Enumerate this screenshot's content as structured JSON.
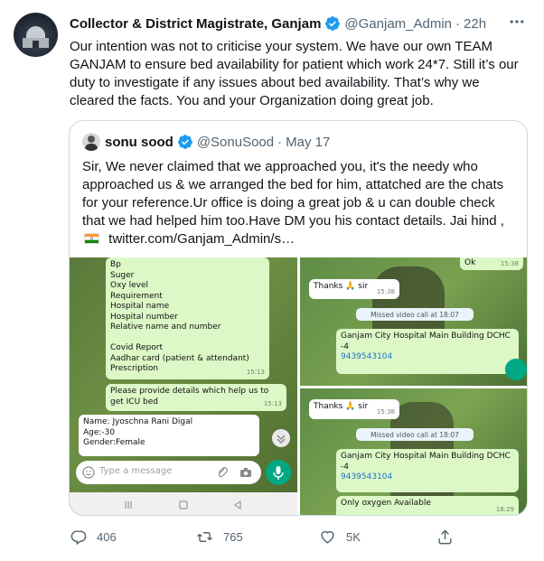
{
  "tweet": {
    "author_name": "Collector & District Magistrate, Ganjam",
    "handle": "@Ganjam_Admin",
    "separator": "·",
    "time": "22h",
    "text": "Our intention was not to criticise your system. We have our own TEAM GANJAM to ensure bed availability for patient which work 24*7. Still it’s our duty to investigate if any issues about bed availability. That’s why we cleared the facts. You and your Organization doing great job."
  },
  "quote": {
    "author_name": "sonu sood",
    "handle": "@SonuSood",
    "separator": "·",
    "date": "May 17",
    "text_main": "Sir, We never claimed that we approached you, it's the needy who approached us & we arranged the bed for him, attatched are the chats for your reference.Ur office is doing a great job & u can double check that we had helped him too.Have DM you his contact details. Jai hind ,",
    "link": "twitter.com/Ganjam_Admin/s…"
  },
  "screenshot1": {
    "checklist": [
      "Bp",
      "Suger",
      "Oxy level",
      "Requirement",
      "Hospital name",
      "Hospital number",
      "Relative name and number",
      "",
      "Covid Report",
      "Aadhar card (patient & attendant)",
      "Prescription"
    ],
    "checklist_time": "15:13",
    "request_text": "Please provide details which help us to get  ICU bed",
    "request_time": "15:13",
    "reply_lines": [
      "Name: Jyoschna Rani Digal",
      "Age:-30",
      "Gender:Female"
    ],
    "input_placeholder": "Type a message"
  },
  "screenshot2": {
    "ok_text": "Ok",
    "ok_time": "15:38",
    "thanks_text": "Thanks 🙏 sir",
    "thanks_time": "15:38",
    "missed_call": "Missed video call at 18:07",
    "hospital_line1": "Ganjam City Hospital Main Building DCHC",
    "hospital_line2": "-4",
    "phone": "9439543104"
  },
  "screenshot3": {
    "thanks_text": "Thanks 🙏 sir",
    "thanks_time": "15:38",
    "missed_call": "Missed video call at 18:07",
    "hospital_line1": "Ganjam City Hospital Main Building DCHC",
    "hospital_line2": "-4",
    "phone": "9439543104",
    "oxygen_text": "Only oxygen Available",
    "oxygen_time": "18:29"
  },
  "actions": {
    "replies": "406",
    "retweets": "765",
    "likes": "5K"
  },
  "colors": {
    "verified": "#1d9bf0",
    "muted": "#536471",
    "wa_green": "#dcf8c6"
  }
}
